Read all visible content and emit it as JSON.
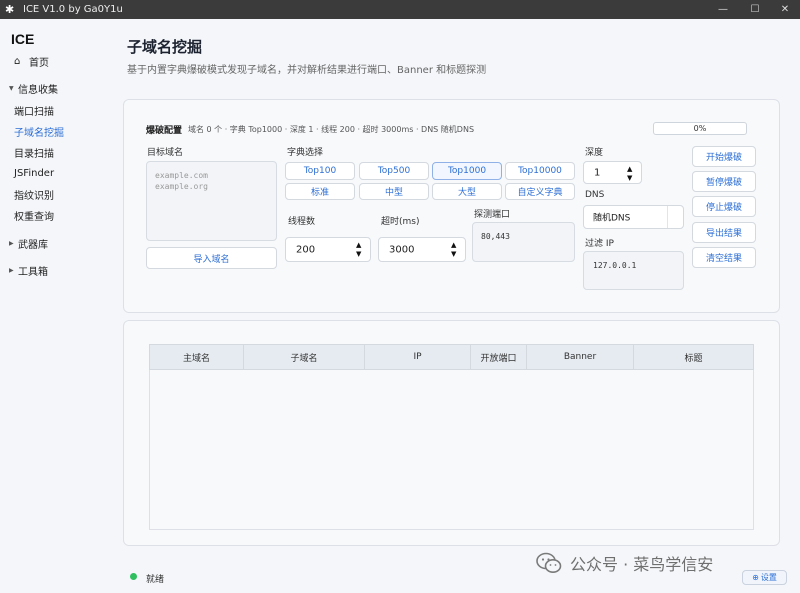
{
  "window": {
    "title": "ICE V1.0 by Ga0Y1u",
    "controls": [
      "—",
      "☐",
      "✕"
    ]
  },
  "sidebar": {
    "brand": "ICE",
    "home": "首页",
    "groups": [
      {
        "label": "信息收集",
        "expanded": true,
        "items": [
          "端口扫描",
          "子域名挖掘",
          "目录扫描",
          "JSFinder",
          "指纹识别",
          "权重查询"
        ]
      },
      {
        "label": "武器库",
        "expanded": false
      },
      {
        "label": "工具箱",
        "expanded": false
      }
    ],
    "active_item": "子域名挖掘"
  },
  "main": {
    "title": "子域名挖掘",
    "description": "基于内置字典爆破模式发现子域名，并对解析结果进行端口、Banner 和标题探测"
  },
  "config": {
    "heading": "爆破配置",
    "summary": "域名 0 个 · 字典 Top1000 · 深度 1 · 线程 200 · 超时 3000ms · DNS 随机DNS",
    "progress_text": "0%",
    "progress_value": 0,
    "target_label": "目标域名",
    "target_placeholder_1": "example.com",
    "target_placeholder_2": "example.org",
    "import_button": "导入域名",
    "dict_label": "字典选择",
    "dict_options": [
      "Top100",
      "Top500",
      "Top1000",
      "Top10000",
      "标准",
      "中型",
      "大型",
      "自定义字典"
    ],
    "dict_selected": "Top1000",
    "threads_label": "线程数",
    "threads_value": "200",
    "timeout_label": "超时(ms)",
    "timeout_value": "3000",
    "ports_label": "探测端口",
    "ports_value": "80,443",
    "depth_label": "深度",
    "depth_value": "1",
    "dns_label": "DNS",
    "dns_value": "随机DNS",
    "filter_label": "过滤 IP",
    "filter_value": "127.0.0.1",
    "actions": [
      "开始爆破",
      "暂停爆破",
      "停止爆破",
      "导出结果",
      "清空结果"
    ]
  },
  "table": {
    "columns": [
      "主域名",
      "子域名",
      "IP",
      "开放端口",
      "Banner",
      "标题"
    ],
    "rows": []
  },
  "status": {
    "text": "就绪",
    "color": "#2fbf5f"
  },
  "watermark": "公众号 · 菜鸟学信安",
  "settings_button": "设置",
  "colors": {
    "accent": "#2d6fd6",
    "titlebar": "#3b3b3b",
    "background": "#f4f6f9"
  }
}
